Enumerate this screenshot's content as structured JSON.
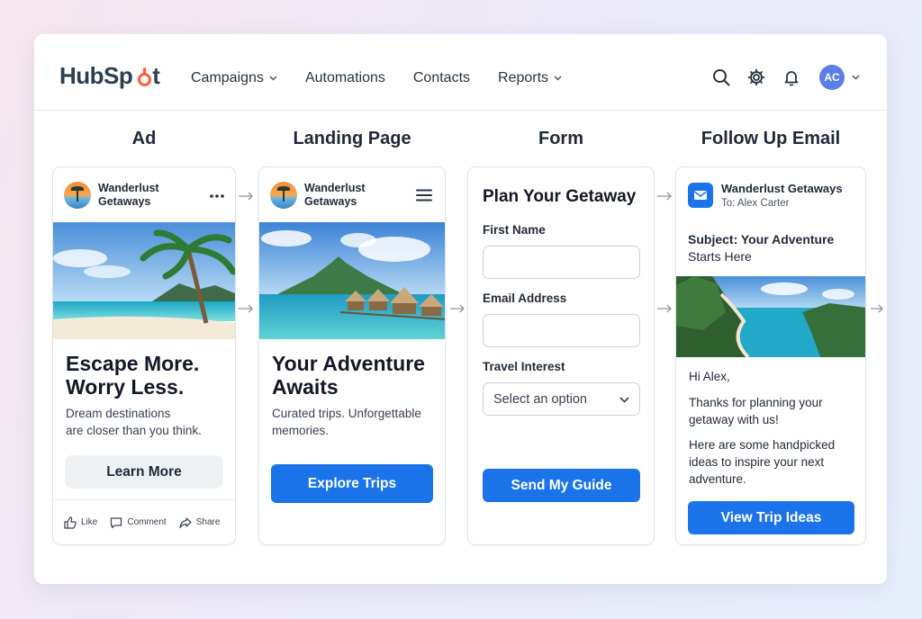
{
  "header": {
    "logo": "HubSpot",
    "nav": [
      {
        "label": "Campaigns",
        "dropdown": true
      },
      {
        "label": "Automations",
        "dropdown": false
      },
      {
        "label": "Contacts",
        "dropdown": false
      },
      {
        "label": "Reports",
        "dropdown": true
      }
    ],
    "avatar_initials": "AC"
  },
  "columns": {
    "ad": "Ad",
    "landing": "Landing Page",
    "form": "Form",
    "email": "Follow Up Email"
  },
  "ad": {
    "brand_line1": "Wanderlust",
    "brand_line2": "Getaways",
    "headline_line1": "Escape More.",
    "headline_line2": "Worry Less.",
    "sub_line1": "Dream destinations",
    "sub_line2": "are closer than you think.",
    "cta": "Learn More",
    "like": "Like",
    "comment": "Comment",
    "share": "Share"
  },
  "landing": {
    "brand_line1": "Wanderlust",
    "brand_line2": "Getaways",
    "headline_line1": "Your Adventure",
    "headline_line2": "Awaits",
    "sub_line1": "Curated trips. Unforgettable",
    "sub_line2": "memories.",
    "cta": "Explore Trips"
  },
  "form": {
    "title": "Plan Your Getaway",
    "first_name_label": "First Name",
    "first_name_value": "",
    "email_label": "Email Address",
    "email_value": "",
    "interest_label": "Travel Interest",
    "interest_selected": "Select an option",
    "submit": "Send My Guide"
  },
  "email": {
    "sender": "Wanderlust Getaways",
    "to": "To: Alex Carter",
    "subject_line1": "Subject: Your Adventure",
    "subject_line2": "Starts Here",
    "greeting": "Hi Alex,",
    "body1_line1": "Thanks for planning your",
    "body1_line2": "getaway with us!",
    "body2_line1": "Here are some handpicked",
    "body2_line2": "ideas to inspire your next",
    "body2_line3": "adventure.",
    "cta": "View Trip Ideas"
  },
  "colors": {
    "accent": "#1a73e8",
    "brand_orange": "#ff5c35",
    "avatar": "#5c7ee6"
  },
  "icons": [
    "search-icon",
    "gear-icon",
    "bell-icon",
    "more-dots-icon",
    "hamburger-menu-icon",
    "mail-icon",
    "like-icon",
    "comment-icon",
    "share-icon"
  ]
}
